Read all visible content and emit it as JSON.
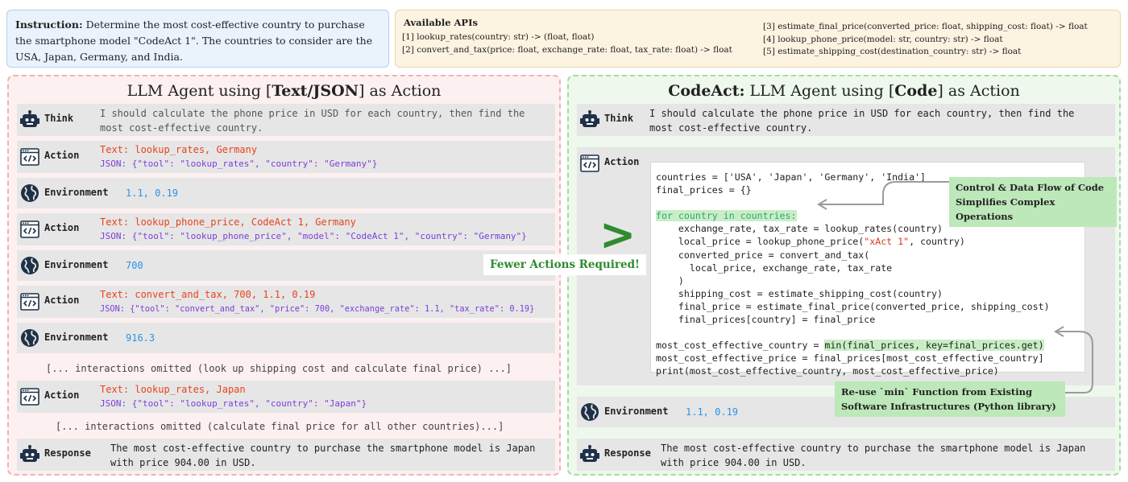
{
  "instruction": {
    "label": "Instruction:",
    "text": " Determine the most cost-effective country to purchase the smartphone model \"CodeAct 1\". The countries to consider are the USA, Japan, Germany, and India."
  },
  "apis": {
    "title": "Available APIs",
    "items": [
      "[1] lookup_rates(country: str) -> (float, float)",
      "[2] convert_and_tax(price: float, exchange_rate: float, tax_rate: float) -> float",
      "[3] estimate_final_price(converted_price: float, shipping_cost: float) -> float",
      "[4] lookup_phone_price(model: str, country: str) -> float",
      "[5] estimate_shipping_cost(destination_country: str) -> float"
    ]
  },
  "left": {
    "title_pre": "LLM Agent using [",
    "title_bold": "Text/JSON",
    "title_post": "] as Action",
    "think_label": "Think",
    "think_text_1": "I should calculate the phone price in USD for each country, then find the",
    "think_text_2": "most cost-effective country.",
    "action_label": "Action",
    "env_label": "Environment",
    "response_label": "Response",
    "a1_text": "Text: lookup_rates, Germany",
    "a1_json": "JSON: {\"tool\": \"lookup_rates\", \"country\": \"Germany\"}",
    "e1": "1.1, 0.19",
    "a2_text": "Text: lookup_phone_price, CodeAct 1, Germany",
    "a2_json": "JSON: {\"tool\": \"lookup_phone_price\", \"model\": \"CodeAct 1\", \"country\": \"Germany\"}",
    "e2": "700",
    "a3_text": "Text: convert_and_tax, 700, 1.1, 0.19",
    "a3_json": "JSON: {\"tool\": \"convert_and_tax\", \"price\": 700, \"exchange_rate\": 1.1, \"tax_rate\": 0.19}",
    "e3": "916.3",
    "omit1": "[... interactions omitted (look up shipping cost and calculate final price) ...]",
    "a4_text": "Text: lookup_rates, Japan",
    "a4_json": "JSON: {\"tool\": \"lookup_rates\", \"country\": \"Japan\"}",
    "omit2": "[... interactions omitted (calculate final price for all other countries)...]",
    "response_1": "The most cost-effective country to purchase the smartphone model is Japan",
    "response_2": "with price 904.00 in USD."
  },
  "right": {
    "title_bold1": "CodeAct:",
    "title_mid": " LLM Agent using [",
    "title_bold2": "Code",
    "title_post": "] as Action",
    "think_label": "Think",
    "think_text_1": "I should calculate the phone price in USD for each country, then find the",
    "think_text_2": "most cost-effective country.",
    "action_label": "Action",
    "code": {
      "l1": "countries = ['USA', 'Japan', 'Germany', 'India']",
      "l2": "final_prices = {}",
      "l3": "for country in countries:",
      "l4": "    exchange_rate, tax_rate = lookup_rates(country)",
      "l5a": "    local_price = lookup_phone_price(",
      "l5b": "\"xAct 1\"",
      "l5c": ", country)",
      "l6": "    converted_price = convert_and_tax(",
      "l7": "      local_price, exchange_rate, tax_rate",
      "l8": "    )",
      "l9": "    shipping_cost = estimate_shipping_cost(country)",
      "l10": "    final_price = estimate_final_price(converted_price, shipping_cost)",
      "l11": "    final_prices[country] = final_price",
      "l12a": "most_cost_effective_country = ",
      "l12b": "min(final_prices, key=final_prices.get)",
      "l13": "most_cost_effective_price = final_prices[most_cost_effective_country]",
      "l14": "print(most_cost_effective_country, most_cost_effective_price)"
    },
    "env_label": "Environment",
    "env_value": "1.1, 0.19",
    "response_label": "Response",
    "response_1": "The most cost-effective country to purchase the smartphone model is Japan",
    "response_2": "with price 904.00 in USD."
  },
  "callouts": {
    "control_flow_1": "Control & Data Flow of Code",
    "control_flow_2": "Simplifies Complex Operations",
    "reuse_1": "Re-use `min` Function from Existing",
    "reuse_2": "Software Infrastructures (Python library)",
    "fewer": "Fewer Actions Required!",
    "gt": ">"
  }
}
